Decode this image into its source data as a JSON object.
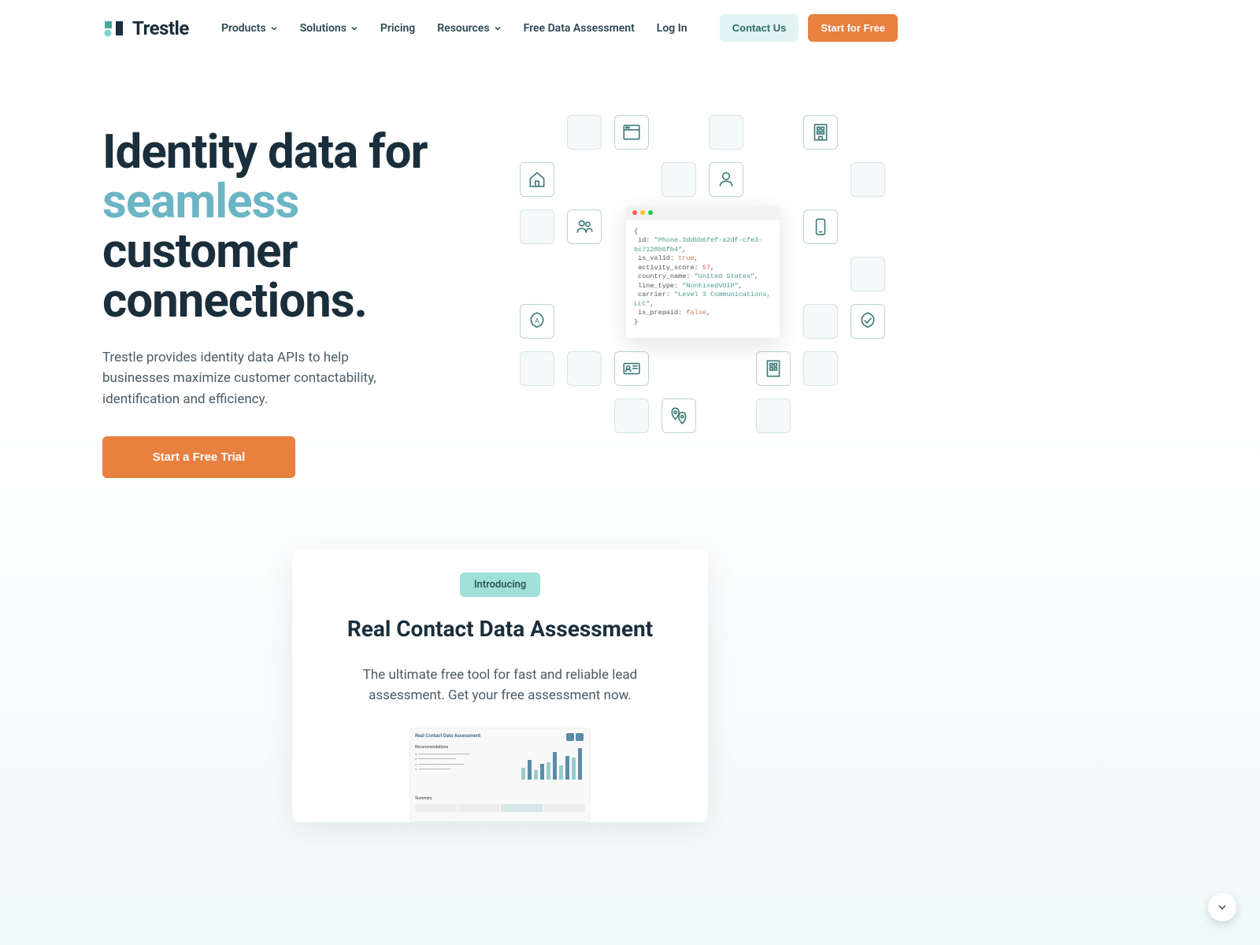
{
  "brand": "Trestle",
  "nav": {
    "items": [
      {
        "label": "Products",
        "dropdown": true
      },
      {
        "label": "Solutions",
        "dropdown": true
      },
      {
        "label": "Pricing",
        "dropdown": false
      },
      {
        "label": "Resources",
        "dropdown": true
      },
      {
        "label": "Free Data Assessment",
        "dropdown": false
      },
      {
        "label": "Log In",
        "dropdown": false
      }
    ],
    "contact": "Contact Us",
    "start": "Start for Free"
  },
  "hero": {
    "title_1": "Identity data for",
    "title_accent": "seamless",
    "title_2": "customer connections.",
    "subtitle": "Trestle provides identity data APIs to help businesses maximize customer contactability, identification and efficiency.",
    "cta": "Start a Free Trial"
  },
  "code": {
    "l1": "{",
    "l2a": "id:",
    "l2b": "\"Phone.3ddbb6fef-a2df-cfe3-bc7128b6fb4\"",
    "l3a": "is_valid:",
    "l3b": "true",
    "l4a": "activity_score:",
    "l4b": "57",
    "l5a": "country_name:",
    "l5b": "\"United States\"",
    "l6a": "line_type:",
    "l6b": "\"NonFixedVOIP\"",
    "l7a": "carrier:",
    "l7b": "\"Level 3 Communications, LLC\"",
    "l8a": "is_prepaid:",
    "l8b": "false",
    "l9": "}"
  },
  "card": {
    "badge": "Introducing",
    "title": "Real Contact Data Assessment",
    "subtitle": "The ultimate free tool for fast and reliable lead assessment. Get your free assessment now.",
    "preview_title": "Real Contact Data Assessment",
    "preview_rec": "Recommendations",
    "preview_sum": "Summary"
  }
}
